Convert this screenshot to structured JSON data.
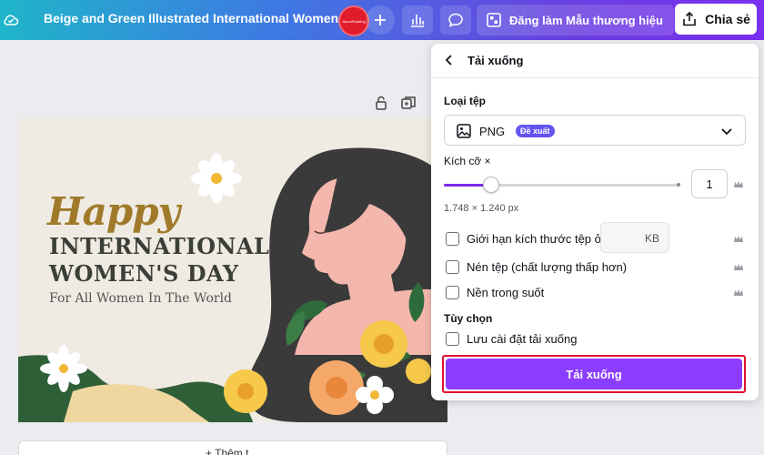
{
  "topbar": {
    "doc_title": "Beige and Green Illustrated International Women...",
    "avatar_text": "AboutReading",
    "brand_button": "Đăng làm Mẫu thương hiệu",
    "share_button": "Chia sẻ",
    "icons": [
      "cloud-icon",
      "plus-icon",
      "chart-icon",
      "comment-icon",
      "brand-icon",
      "share-icon"
    ]
  },
  "design": {
    "happy": "Happy",
    "line1": "INTERNATIONAL",
    "line2": "WOMEN'S DAY",
    "subtitle": "For All Women In The World",
    "below_label": "+ Thêm t..."
  },
  "panel": {
    "title": "Tải xuống",
    "file_type_label": "Loại tệp",
    "file_type_value": "PNG",
    "recommended_badge": "Đề xuất",
    "size_label": "Kích cỡ ×",
    "size_value": "1",
    "size_slider_fraction": 0.2,
    "dimensions": "1.748 × 1.240 px",
    "options": [
      {
        "label": "Giới hạn kích thước tệp ở",
        "checked": false
      },
      {
        "label": "Nén tệp (chất lượng thấp hơn)",
        "checked": false
      },
      {
        "label": "Nền trong suốt",
        "checked": false
      }
    ],
    "kb_unit": "KB",
    "preferences_label": "Tùy chọn",
    "save_settings_label": "Lưu cài đặt tải xuống",
    "download_button": "Tải xuống"
  },
  "colors": {
    "accent": "#8b3dff",
    "highlight_border": "#e0102e",
    "badge": "#6453f0"
  }
}
